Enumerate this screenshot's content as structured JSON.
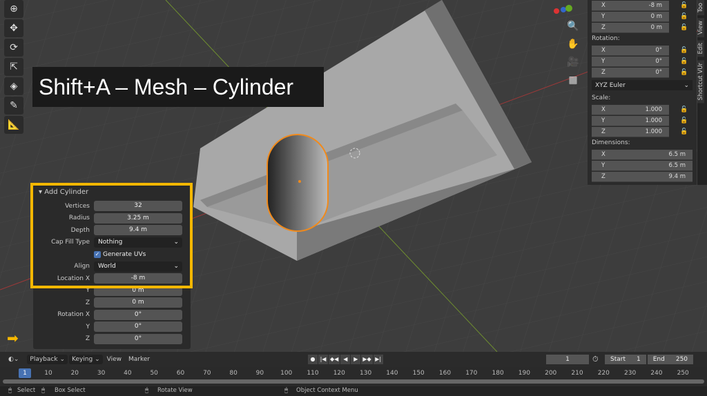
{
  "caption": "Shift+A – Mesh – Cylinder",
  "toolbar": {
    "tools": [
      "cursor-icon",
      "move-icon",
      "rotate-icon",
      "scale-icon",
      "transform-icon",
      "annotate-icon",
      "measure-icon"
    ]
  },
  "navigation": {
    "icons": [
      "zoom-icon",
      "hand-pan-icon",
      "camera-icon",
      "grid-icon"
    ]
  },
  "npanel": {
    "location": [
      {
        "axis": "X",
        "value": "-8 m"
      },
      {
        "axis": "Y",
        "value": "0 m"
      },
      {
        "axis": "Z",
        "value": "0 m"
      }
    ],
    "rotation_label": "Rotation:",
    "rotation": [
      {
        "axis": "X",
        "value": "0°"
      },
      {
        "axis": "Y",
        "value": "0°"
      },
      {
        "axis": "Z",
        "value": "0°"
      }
    ],
    "rotation_mode": "XYZ Euler",
    "scale_label": "Scale:",
    "scale": [
      {
        "axis": "X",
        "value": "1.000"
      },
      {
        "axis": "Y",
        "value": "1.000"
      },
      {
        "axis": "Z",
        "value": "1.000"
      }
    ],
    "dimensions_label": "Dimensions:",
    "dimensions": [
      {
        "axis": "X",
        "value": "6.5 m"
      },
      {
        "axis": "Y",
        "value": "6.5 m"
      },
      {
        "axis": "Z",
        "value": "9.4 m"
      }
    ],
    "tabs": [
      "Too",
      "View",
      "Edit",
      "Shortcut VUr"
    ]
  },
  "operator": {
    "title": "Add Cylinder",
    "vertices_label": "Vertices",
    "vertices": "32",
    "radius_label": "Radius",
    "radius": "3.25 m",
    "depth_label": "Depth",
    "depth": "9.4 m",
    "cap_label": "Cap Fill Type",
    "cap": "Nothing",
    "uvs_label": "Generate UVs",
    "align_label": "Align",
    "align": "World",
    "locx_label": "Location X",
    "locx": "-8 m",
    "y_label": "Y",
    "locy": "0 m",
    "z_label": "Z",
    "locz": "0 m",
    "rotx_label": "Rotation X",
    "rotx": "0°",
    "roty": "0°",
    "rotz": "0°"
  },
  "timeline": {
    "menus": [
      "Playback",
      "Keying",
      "View",
      "Marker"
    ],
    "current_frame": "1",
    "start_label": "Start",
    "start": "1",
    "end_label": "End",
    "end": "250",
    "ticks": [
      "10",
      "20",
      "30",
      "40",
      "50",
      "60",
      "70",
      "80",
      "90",
      "100",
      "110",
      "120",
      "130",
      "140",
      "150",
      "160",
      "170",
      "180",
      "190",
      "200",
      "210",
      "220",
      "230",
      "240",
      "250"
    ]
  },
  "status": {
    "select": "Select",
    "box_select": "Box Select",
    "rotate": "Rotate View",
    "context": "Object Context Menu"
  },
  "colors": {
    "highlight": "#f5b700",
    "accent": "#4772b3",
    "selection": "#f08a1c"
  }
}
